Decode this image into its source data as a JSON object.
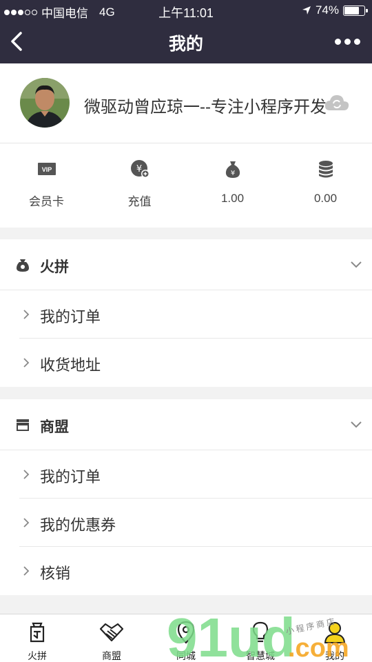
{
  "status": {
    "carrier": "中国电信",
    "network": "4G",
    "time": "上午11:01",
    "battery": "74%",
    "battery_level": 0.74
  },
  "nav": {
    "title": "我的"
  },
  "profile": {
    "name": "微驱动曾应琼一--专注小程序开发"
  },
  "stats": [
    {
      "icon": "vip-card-icon",
      "label": "会员卡"
    },
    {
      "icon": "recharge-icon",
      "label": "充值"
    },
    {
      "icon": "money-bag-icon",
      "label": "1.00"
    },
    {
      "icon": "coins-stack-icon",
      "label": "0.00"
    }
  ],
  "sections": [
    {
      "icon": "bag-icon",
      "title": "火拼",
      "items": [
        "我的订单",
        "收货地址"
      ]
    },
    {
      "icon": "store-icon",
      "title": "商盟",
      "items": [
        "我的订单",
        "我的优惠券",
        "核销"
      ]
    }
  ],
  "tabs": [
    {
      "icon": "group-buy-icon",
      "label": "火拼"
    },
    {
      "icon": "handshake-icon",
      "label": "商盟"
    },
    {
      "icon": "location-pin-icon",
      "label": "同城"
    },
    {
      "icon": "lightbulb-icon",
      "label": "智慧城"
    },
    {
      "icon": "user-icon",
      "label": "我的"
    }
  ],
  "watermark": {
    "text": "91ud",
    "domain": ".com",
    "tagline": "小程序商店"
  },
  "colors": {
    "header_bg": "#2f2d3f",
    "page_bg": "#f2f2f2",
    "watermark_green": "#7ddc8a",
    "watermark_orange": "#f5a623"
  }
}
